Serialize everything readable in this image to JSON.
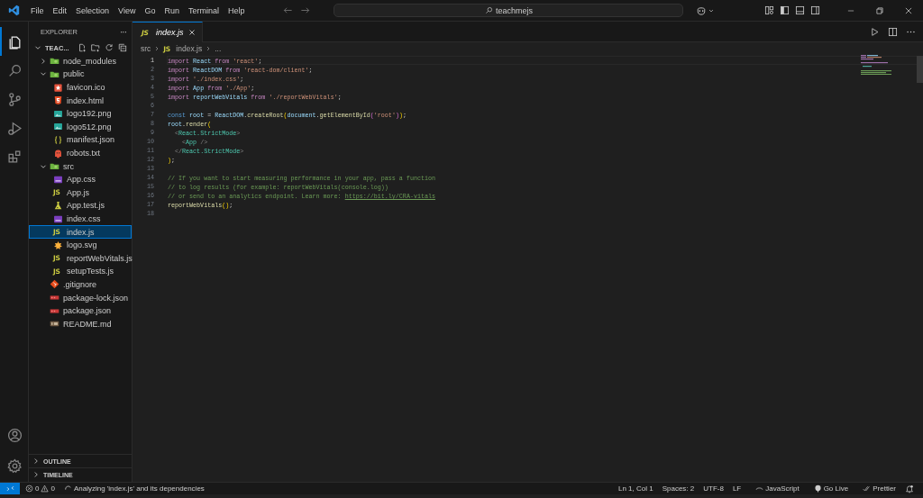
{
  "titlebar": {
    "menu": [
      "File",
      "Edit",
      "Selection",
      "View",
      "Go",
      "Run",
      "Terminal",
      "Help"
    ],
    "search": {
      "value": "teachmejs"
    }
  },
  "activity_bar": {
    "items": [
      {
        "selected": true
      },
      {
        "selected": false
      },
      {
        "selected": false
      },
      {
        "selected": false
      },
      {
        "selected": false
      }
    ]
  },
  "sidebar": {
    "title": "EXPLORER",
    "more": "···",
    "tree": {
      "label": "TEAC...",
      "expanded": true,
      "children": [
        {
          "label": "node_modules",
          "kind": "folder",
          "expanded": false,
          "selected": false
        },
        {
          "label": "public",
          "kind": "folder",
          "expanded": true,
          "selected": false,
          "children": [
            {
              "label": "favicon.ico",
              "kind": "favicon",
              "selected": false
            },
            {
              "label": "index.html",
              "kind": "html",
              "selected": false
            },
            {
              "label": "logo192.png",
              "kind": "image",
              "selected": false
            },
            {
              "label": "logo512.png",
              "kind": "image",
              "selected": false
            },
            {
              "label": "manifest.json",
              "kind": "json",
              "selected": false
            },
            {
              "label": "robots.txt",
              "kind": "robot",
              "selected": false
            }
          ]
        },
        {
          "label": "src",
          "kind": "folder",
          "expanded": true,
          "selected": false,
          "children": [
            {
              "label": "App.css",
              "kind": "css",
              "selected": false
            },
            {
              "label": "App.js",
              "kind": "js",
              "icon_text": "JS",
              "selected": false
            },
            {
              "label": "App.test.js",
              "kind": "test",
              "selected": false
            },
            {
              "label": "index.css",
              "kind": "css",
              "selected": false
            },
            {
              "label": "index.js",
              "kind": "js",
              "icon_text": "JS",
              "selected": true
            },
            {
              "label": "logo.svg",
              "kind": "svg",
              "selected": false
            },
            {
              "label": "reportWebVitals.js",
              "kind": "js",
              "icon_text": "JS",
              "selected": false
            },
            {
              "label": "setupTests.js",
              "kind": "js",
              "icon_text": "JS",
              "selected": false
            }
          ]
        },
        {
          "label": ".gitignore",
          "kind": "git",
          "selected": false
        },
        {
          "label": "package-lock.json",
          "kind": "npm",
          "selected": false
        },
        {
          "label": "package.json",
          "kind": "npm",
          "selected": false
        },
        {
          "label": "README.md",
          "kind": "readme",
          "selected": false
        }
      ]
    },
    "sections": [
      {
        "label": "OUTLINE",
        "expanded": false
      },
      {
        "label": "TIMELINE",
        "expanded": false
      }
    ]
  },
  "editor": {
    "tabs": [
      {
        "label": "index.js",
        "icon_text": "JS",
        "selected": true
      }
    ],
    "breadcrumb": [
      {
        "label": "src"
      },
      {
        "label": "index.js",
        "icon_text": "JS"
      },
      {
        "label": "..."
      }
    ],
    "lines": [
      {
        "number": "1",
        "active": true,
        "tokens": [
          {
            "kind": "kw",
            "t": "import"
          },
          {
            "kind": "var",
            "t": " React"
          },
          {
            "kind": "kw",
            "t": " from"
          },
          {
            "kind": "str",
            "t": " 'react'"
          },
          {
            "kind": "plain",
            "t": ";"
          }
        ]
      },
      {
        "number": "2",
        "active": false,
        "tokens": [
          {
            "kind": "kw",
            "t": "import"
          },
          {
            "kind": "var",
            "t": " ReactDOM"
          },
          {
            "kind": "kw",
            "t": " from"
          },
          {
            "kind": "str",
            "t": " 'react-dom/client'"
          },
          {
            "kind": "plain",
            "t": ";"
          }
        ]
      },
      {
        "number": "3",
        "active": false,
        "tokens": [
          {
            "kind": "kw",
            "t": "import"
          },
          {
            "kind": "str",
            "t": " './index.css'"
          },
          {
            "kind": "plain",
            "t": ";"
          }
        ]
      },
      {
        "number": "4",
        "active": false,
        "tokens": [
          {
            "kind": "kw",
            "t": "import"
          },
          {
            "kind": "var",
            "t": " App"
          },
          {
            "kind": "kw",
            "t": " from"
          },
          {
            "kind": "str",
            "t": " './App'"
          },
          {
            "kind": "plain",
            "t": ";"
          }
        ]
      },
      {
        "number": "5",
        "active": false,
        "tokens": [
          {
            "kind": "kw",
            "t": "import"
          },
          {
            "kind": "var",
            "t": " reportWebVitals"
          },
          {
            "kind": "kw",
            "t": " from"
          },
          {
            "kind": "str",
            "t": " './reportWebVitals'"
          },
          {
            "kind": "plain",
            "t": ";"
          }
        ]
      },
      {
        "number": "6",
        "active": false
      },
      {
        "number": "7",
        "active": false,
        "tokens": [
          {
            "kind": "const",
            "t": "const"
          },
          {
            "kind": "var",
            "t": " root"
          },
          {
            "kind": "plain",
            "t": " = "
          },
          {
            "kind": "var",
            "t": "ReactDOM"
          },
          {
            "kind": "plain",
            "t": "."
          },
          {
            "kind": "fn",
            "t": "createRoot"
          },
          {
            "kind": "br1",
            "t": "("
          },
          {
            "kind": "var",
            "t": "document"
          },
          {
            "kind": "plain",
            "t": "."
          },
          {
            "kind": "fn",
            "t": "getElementById"
          },
          {
            "kind": "br2",
            "t": "("
          },
          {
            "kind": "str",
            "t": "'root'"
          },
          {
            "kind": "br2",
            "t": ")"
          },
          {
            "kind": "br1",
            "t": ")"
          },
          {
            "kind": "plain",
            "t": ";"
          }
        ]
      },
      {
        "number": "8",
        "active": false,
        "tokens": [
          {
            "kind": "var",
            "t": "root"
          },
          {
            "kind": "plain",
            "t": "."
          },
          {
            "kind": "fn",
            "t": "render"
          },
          {
            "kind": "br1",
            "t": "("
          }
        ]
      },
      {
        "number": "9",
        "active": false,
        "tokens": [
          {
            "kind": "angle",
            "t": "  <"
          },
          {
            "kind": "tag",
            "t": "React.StrictMode"
          },
          {
            "kind": "angle",
            "t": ">"
          }
        ]
      },
      {
        "number": "10",
        "active": false,
        "tokens": [
          {
            "kind": "angle",
            "t": "    <"
          },
          {
            "kind": "tag",
            "t": "App"
          },
          {
            "kind": "angle",
            "t": " />"
          }
        ]
      },
      {
        "number": "11",
        "active": false,
        "tokens": [
          {
            "kind": "angle",
            "t": "  </"
          },
          {
            "kind": "tag",
            "t": "React.StrictMode"
          },
          {
            "kind": "angle",
            "t": ">"
          }
        ]
      },
      {
        "number": "12",
        "active": false,
        "tokens": [
          {
            "kind": "br1",
            "t": ")"
          },
          {
            "kind": "plain",
            "t": ";"
          }
        ]
      },
      {
        "number": "13",
        "active": false
      },
      {
        "number": "14",
        "active": false,
        "tokens": [
          {
            "kind": "comment",
            "t": "// If you want to start measuring performance in your app, pass a function"
          }
        ]
      },
      {
        "number": "15",
        "active": false,
        "tokens": [
          {
            "kind": "comment",
            "t": "// to log results (for example: reportWebVitals(console.log))"
          }
        ]
      },
      {
        "number": "16",
        "active": false,
        "tokens": [
          {
            "kind": "comment",
            "t": "// or send to an analytics endpoint. Learn more: "
          },
          {
            "kind": "link",
            "t": "https://bit.ly/CRA-vitals"
          }
        ]
      },
      {
        "number": "17",
        "active": false,
        "tokens": [
          {
            "kind": "fn",
            "t": "reportWebVitals"
          },
          {
            "kind": "br1",
            "t": "()"
          },
          {
            "kind": "plain",
            "t": ";"
          }
        ]
      },
      {
        "number": "18",
        "active": false
      }
    ]
  },
  "status_bar": {
    "errors": "0",
    "warnings": "0",
    "message": "Analyzing 'index.js' and its dependencies",
    "right": [
      {
        "kind": "text",
        "label": "Ln 1, Col 1"
      },
      {
        "kind": "text",
        "label": "Spaces: 2"
      },
      {
        "kind": "text",
        "label": "UTF-8"
      },
      {
        "kind": "text",
        "label": "LF"
      },
      {
        "kind": "language",
        "label": "JavaScript"
      },
      {
        "kind": "golive",
        "label": "Go Live"
      },
      {
        "kind": "prettier",
        "label": "Prettier"
      },
      {
        "kind": "bell"
      }
    ]
  }
}
